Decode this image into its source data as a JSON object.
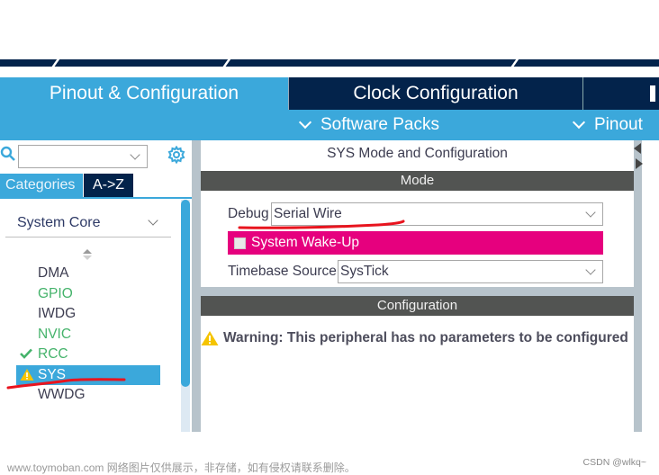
{
  "tabs": {
    "pinout_config": "Pinout & Configuration",
    "clock_config": "Clock Configuration"
  },
  "sub_bar": {
    "software_packs": "Software Packs",
    "pinout": "Pinout"
  },
  "left_panel": {
    "search_value": "",
    "category_tabs": [
      "Categories",
      "A->Z"
    ],
    "active_category_tab": "Categories",
    "group_label": "System Core",
    "peripherals": [
      {
        "name": "DMA",
        "status": "default"
      },
      {
        "name": "GPIO",
        "status": "configured"
      },
      {
        "name": "IWDG",
        "status": "default"
      },
      {
        "name": "NVIC",
        "status": "configured"
      },
      {
        "name": "RCC",
        "status": "ok"
      },
      {
        "name": "SYS",
        "status": "warning",
        "selected": true
      },
      {
        "name": "WWDG",
        "status": "default"
      }
    ]
  },
  "right_panel": {
    "title": "SYS Mode and Configuration",
    "mode_header": "Mode",
    "debug_label": "Debug",
    "debug_value": "Serial Wire",
    "wakeup_label": "System Wake-Up",
    "wakeup_checked": false,
    "timebase_label": "Timebase Source",
    "timebase_value": "SysTick",
    "config_header": "Configuration",
    "warning_text": "Warning: This peripheral has no parameters to be configured"
  },
  "footer": {
    "watermark": "www.toymoban.com 网络图片仅供展示，非存储，如有侵权请联系删除。",
    "credit": "CSDN @wlkq~"
  },
  "colors": {
    "accent_blue": "#3ba8db",
    "navy": "#03234b",
    "configured_green": "#45b36b",
    "wakeup_magenta": "#e6007e",
    "warning_yellow": "#f5c400",
    "annotation_red": "#e8141e"
  }
}
